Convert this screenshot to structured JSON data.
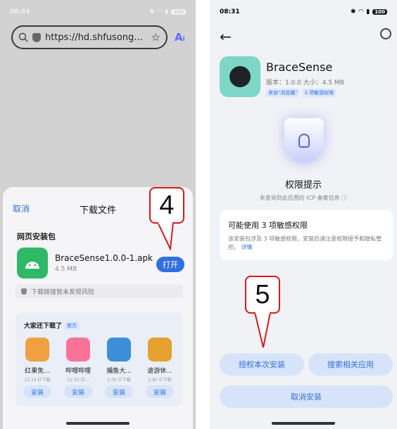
{
  "left": {
    "status": {
      "time": "08:34",
      "battery": "100"
    },
    "browser": {
      "url": "https://hd.shfusong..."
    },
    "sheet": {
      "cancel": "取消",
      "title": "下载文件",
      "section_label": "网页安装包",
      "file_name": "BraceSense1.0.0-1.apk",
      "file_size": "4.5 MB",
      "open_button": "打开",
      "risk_note": "下载链接暂未发现风险",
      "recommend_title": "大家还下载了",
      "official_badge": "官方",
      "apps": [
        {
          "name": "红果免...",
          "downloads": "15.14 亿下载",
          "install": "安装",
          "color": "#f0a040"
        },
        {
          "name": "哔哩哔哩",
          "downloads": "52.55 亿...",
          "install": "安装",
          "color": "#fb7299"
        },
        {
          "name": "捕鱼大...",
          "downloads": "2.00 亿下载",
          "install": "安装",
          "color": "#3c8fd8"
        },
        {
          "name": "途游休...",
          "downloads": "2.80 亿下载",
          "install": "安装",
          "color": "#e5a030"
        }
      ]
    },
    "callout": "4"
  },
  "right": {
    "status": {
      "time": "08:31",
      "battery": "100"
    },
    "app_name": "BraceSense",
    "meta": "版本：1.0.0   大小：4.5 MB",
    "tags": [
      "来自\"浏览器\"",
      "3 项敏感权限"
    ],
    "perm_title": "权限提示",
    "perm_sub": "未查询到此应用的 ICP 备案信息 ⓘ",
    "risk_title": "可能使用 3 项敏感权限",
    "risk_body": "该安装包涉及 3 项敏感权限，安装后请注意权限授予和隐私管控。",
    "risk_more": "详情",
    "btn_authorize": "授权本次安装",
    "btn_search": "搜索相关应用",
    "btn_cancel": "取消安装",
    "callout": "5"
  },
  "colors": {
    "accent": "#2f6fe0",
    "callout_border": "#d71a1a"
  }
}
